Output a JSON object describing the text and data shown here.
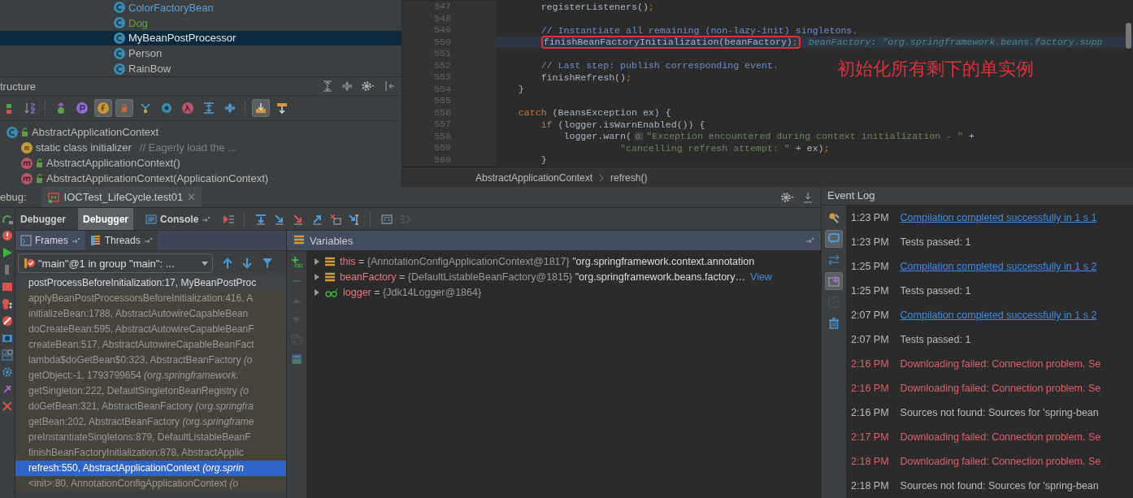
{
  "project_tree": {
    "items": [
      {
        "label": "ColorFactoryBean",
        "color": "#5aa0d8",
        "selected": false
      },
      {
        "label": "Dog",
        "color": "#62a14b",
        "selected": false
      },
      {
        "label": "MyBeanPostProcessor",
        "selected": true
      },
      {
        "label": "Person",
        "selected": false
      },
      {
        "label": "RainBow",
        "selected": false
      }
    ]
  },
  "structure": {
    "title": "tructure",
    "toolbar": [
      {
        "kind": "lock-pair",
        "on": false
      },
      {
        "kind": "sort",
        "on": false
      },
      {
        "kind": "up-arrow",
        "on": false
      },
      {
        "kind": "p",
        "on": false
      },
      {
        "kind": "f",
        "on": true
      },
      {
        "kind": "lock",
        "on": true
      },
      {
        "kind": "fork",
        "on": false
      },
      {
        "kind": "ring",
        "on": false
      },
      {
        "kind": "lambda",
        "on": false
      },
      {
        "kind": "expand",
        "on": false
      },
      {
        "kind": "collapse",
        "on": false
      },
      {
        "kind": "scroll-to",
        "on": true
      },
      {
        "kind": "scroll-from",
        "on": false
      }
    ],
    "tree": [
      {
        "label": "AbstractApplicationContext",
        "kind": "class",
        "children": [
          {
            "label": "static class initializer",
            "comment": "// Eagerly load the ...",
            "kind": "initializer"
          },
          {
            "label": "AbstractApplicationContext()",
            "kind": "method"
          },
          {
            "label": "AbstractApplicationContext(ApplicationContext)",
            "kind": "method"
          }
        ]
      }
    ]
  },
  "editor": {
    "lines": [
      {
        "number": "547",
        "current": false,
        "tokens": [
          {
            "text": "        registerListeners()",
            "kind": "plain"
          },
          {
            "text": ";",
            "kind": "keyword"
          }
        ]
      },
      {
        "number": "548",
        "current": false
      },
      {
        "number": "549",
        "current": false,
        "tokens": [
          {
            "text": "        // Instantiate all remaining (non-lazy-init) singletons.",
            "kind": "comment"
          }
        ]
      },
      {
        "number": "550",
        "current": true,
        "tokens": [
          {
            "text": "        finishBeanFactoryInitialization(beanFactory)",
            "kind": "plain",
            "boxed": true
          },
          {
            "text": ";",
            "kind": "keyword",
            "boxed": true
          }
        ],
        "inline_value": "beanFactory: \"org.springframework.beans.factory.supp"
      },
      {
        "number": "551",
        "current": false
      },
      {
        "number": "552",
        "current": false,
        "tokens": [
          {
            "text": "        // Last step: publish corresponding event.",
            "kind": "comment"
          }
        ]
      },
      {
        "number": "553",
        "current": false,
        "tokens": [
          {
            "text": "        finishRefresh()",
            "kind": "plain"
          },
          {
            "text": ";",
            "kind": "keyword"
          }
        ]
      },
      {
        "number": "554",
        "current": false,
        "tokens": [
          {
            "text": "    }",
            "kind": "plain"
          }
        ]
      },
      {
        "number": "555",
        "current": false
      },
      {
        "number": "556",
        "current": false,
        "tokens": [
          {
            "text": "    catch",
            "kind": "keyword"
          },
          {
            "text": " (BeansException ex) {",
            "kind": "plain"
          }
        ]
      },
      {
        "number": "557",
        "current": false,
        "tokens": [
          {
            "text": "        if",
            "kind": "keyword"
          },
          {
            "text": " (logger.isWarnEnabled()) {",
            "kind": "plain"
          }
        ]
      },
      {
        "number": "558",
        "current": false,
        "tokens": [
          {
            "text": "            logger.warn(",
            "kind": "plain"
          },
          {
            "text": "o:",
            "kind": "param-hint"
          },
          {
            "text": "\"Exception encountered during context initialization - \"",
            "kind": "string"
          },
          {
            "text": " +",
            "kind": "plain"
          }
        ]
      },
      {
        "number": "559",
        "current": false,
        "tokens": [
          {
            "text": "                      \"cancelling refresh attempt: \"",
            "kind": "string"
          },
          {
            "text": " + ex)",
            "kind": "plain"
          },
          {
            "text": ";",
            "kind": "keyword"
          }
        ]
      },
      {
        "number": "560",
        "current": false,
        "tokens": [
          {
            "text": "        }",
            "kind": "plain"
          }
        ]
      }
    ],
    "annotation": "初始化所有剩下的单实例",
    "breadcrumbs": [
      "AbstractApplicationContext",
      "refresh()"
    ]
  },
  "debug": {
    "label": "ebug:",
    "session": "IOCTest_LifeCycle.test01",
    "tabs": [
      {
        "label": "Debugger",
        "selected": false
      },
      {
        "label": "Debugger",
        "selected": true
      },
      {
        "label": "Console",
        "selected": false
      }
    ],
    "panel_tabs": [
      {
        "label": "Frames",
        "selected": true
      },
      {
        "label": "Threads",
        "selected": false
      }
    ],
    "thread": "\"main\"@1 in group \"main\": ...",
    "frames": [
      {
        "text": "postProcessBeforeInitialization:17, MyBeanPostProc",
        "kind": "current",
        "selected": false
      },
      {
        "text": "applyBeanPostProcessorsBeforeInitialization:416, A",
        "kind": "library",
        "selected": false
      },
      {
        "text": "initializeBean:1788, AbstractAutowireCapableBean",
        "kind": "library",
        "selected": false
      },
      {
        "text": "doCreateBean:595, AbstractAutowireCapableBeanF",
        "kind": "library",
        "selected": false
      },
      {
        "text": "createBean:517, AbstractAutowireCapableBeanFact",
        "kind": "library",
        "selected": false
      },
      {
        "text": "lambda$doGetBean$0:323, AbstractBeanFactory",
        "package": "(o",
        "kind": "library",
        "selected": false
      },
      {
        "text": "getObject:-1, 1793799654",
        "package": "(org.springframework.",
        "kind": "library",
        "selected": false
      },
      {
        "text": "getSingleton:222, DefaultSingletonBeanRegistry",
        "package": "(o",
        "kind": "library",
        "selected": false
      },
      {
        "text": "doGetBean:321, AbstractBeanFactory",
        "package": "(org.springfra",
        "kind": "library",
        "selected": false
      },
      {
        "text": "getBean:202, AbstractBeanFactory",
        "package": "(org.springframe",
        "kind": "library",
        "selected": false
      },
      {
        "text": "preInstantiateSingletons:879, DefaultListableBeanF",
        "kind": "library",
        "selected": false
      },
      {
        "text": "finishBeanFactoryInitialization:878, AbstractApplic",
        "kind": "library",
        "selected": false
      },
      {
        "text": "refresh:550, AbstractApplicationContext",
        "package": "(org.sprin",
        "kind": "library",
        "selected": true
      },
      {
        "text": "<init>:80, AnnotationConfigApplicationContext",
        "package": "(o",
        "kind": "library",
        "selected": false
      }
    ],
    "variables_title": "Variables",
    "variables": [
      {
        "name": "this",
        "kind": "field",
        "operator": "=",
        "value": "{AnnotationConfigApplicationContext@1817}",
        "string": "\"org.springframework.context.annotation"
      },
      {
        "name": "beanFactory",
        "kind": "field",
        "operator": "=",
        "value": "{DefaultListableBeanFactory@1815}",
        "string": "\"org.springframework.beans.factory…",
        "link": "View"
      },
      {
        "name": "logger",
        "kind": "watch",
        "operator": "=",
        "value": "{Jdk14Logger@1864}"
      }
    ]
  },
  "event_log": {
    "title": "Event Log",
    "tools": [
      {
        "kind": "wrench",
        "on": false
      },
      {
        "kind": "bubble",
        "on": true
      },
      {
        "kind": "arrows",
        "on": false
      },
      {
        "kind": "scroll",
        "on": true
      },
      {
        "kind": "check",
        "on": false
      },
      {
        "kind": "trash",
        "on": false
      }
    ],
    "entries": [
      {
        "time": "1:23 PM",
        "message": "Compilation completed successfully in 1 s 1",
        "kind": "link"
      },
      {
        "time": "1:23 PM",
        "message": "Tests passed: 1",
        "kind": "info"
      },
      {
        "time": "1:25 PM",
        "message": "Compilation completed successfully in 1 s 2",
        "kind": "link"
      },
      {
        "time": "1:25 PM",
        "message": "Tests passed: 1",
        "kind": "info"
      },
      {
        "time": "2:07 PM",
        "message": "Compilation completed successfully in 1 s 2",
        "kind": "link"
      },
      {
        "time": "2:07 PM",
        "message": "Tests passed: 1",
        "kind": "info"
      },
      {
        "time": "2:16 PM",
        "message": "Downloading failed: Connection problem. Se",
        "kind": "error"
      },
      {
        "time": "2:16 PM",
        "message": "Downloading failed: Connection problem. Se",
        "kind": "error"
      },
      {
        "time": "2:16 PM",
        "message": "Sources not found: Sources for 'spring-bean",
        "kind": "info"
      },
      {
        "time": "2:17 PM",
        "message": "Downloading failed: Connection problem. Se",
        "kind": "error"
      },
      {
        "time": "2:18 PM",
        "message": "Downloading failed: Connection problem. Se",
        "kind": "error"
      },
      {
        "time": "2:18 PM",
        "message": "Sources not found: Sources for 'spring-bean",
        "kind": "info"
      }
    ]
  }
}
